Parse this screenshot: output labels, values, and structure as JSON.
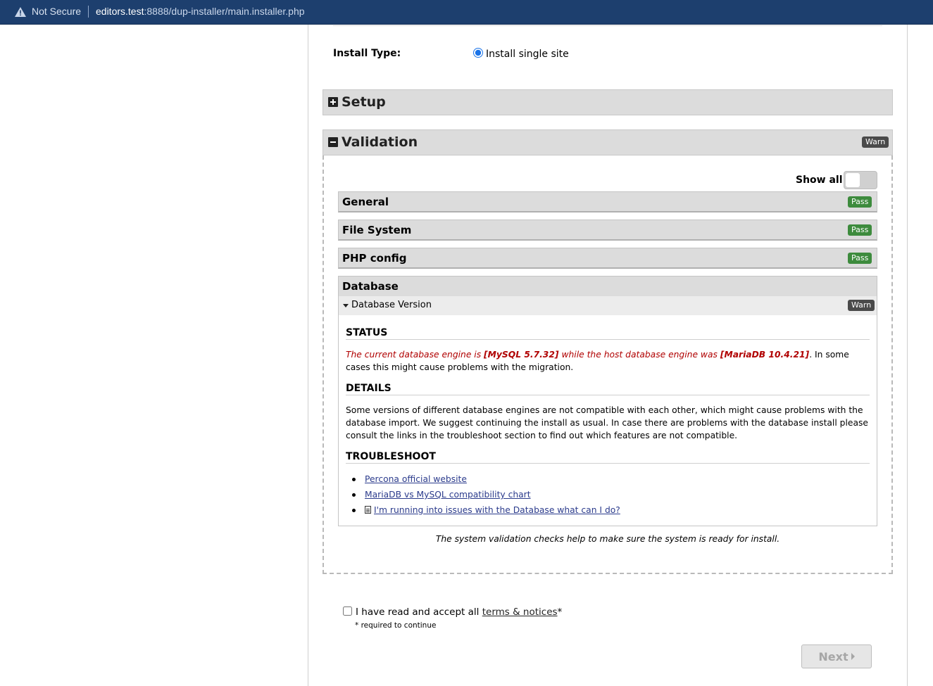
{
  "browser": {
    "security_label": "Not Secure",
    "url_host": "editors.test",
    "url_rest": ":8888/dup-installer/main.installer.php"
  },
  "install_type": {
    "label": "Install Type:",
    "option_label": "Install single site",
    "selected": true
  },
  "sections": {
    "setup": {
      "title": "Setup",
      "expanded": false
    },
    "validation": {
      "title": "Validation",
      "expanded": true,
      "badge": "Warn"
    }
  },
  "validation": {
    "show_all_label": "Show all",
    "show_all_on": false,
    "checks": [
      {
        "title": "General",
        "badge": "Pass"
      },
      {
        "title": "File System",
        "badge": "Pass"
      },
      {
        "title": "PHP config",
        "badge": "Pass"
      }
    ],
    "database": {
      "title": "Database",
      "item_label": "Database Version",
      "item_badge": "Warn",
      "status_heading": "STATUS",
      "status_red_1": "The current database engine is ",
      "status_red_bold_1": "[MySQL 5.7.32]",
      "status_red_2": " while the host database engine was ",
      "status_red_bold_2": "[MariaDB 10.4.21]",
      "status_tail": ". In some cases this might cause problems with the migration.",
      "details_heading": "DETAILS",
      "details_text": "Some versions of different database engines are not compatible with each other, which might cause problems with the database import. We suggest continuing the install as usual. In case there are problems with the database install please consult the links in the troubleshoot section to find out which features are not compatible.",
      "troubleshoot_heading": "TROUBLESHOOT",
      "links": [
        "Percona official website",
        "MariaDB vs MySQL compatibility chart",
        "I'm running into issues with the Database what can I do?"
      ]
    },
    "note": "The system validation checks help to make sure the system is ready for install."
  },
  "accept": {
    "text_before": "I have read and accept all ",
    "link_text": "terms & notices",
    "asterisk": "*",
    "required_note": "* required to continue",
    "checked": false
  },
  "next_button": {
    "label": "Next"
  },
  "colors": {
    "address_bar": "#1d3f6e",
    "pass_badge": "#3d8b3d",
    "warn_badge": "#4a4a4a",
    "error_text": "#b00000",
    "link": "#2b3b8c"
  }
}
